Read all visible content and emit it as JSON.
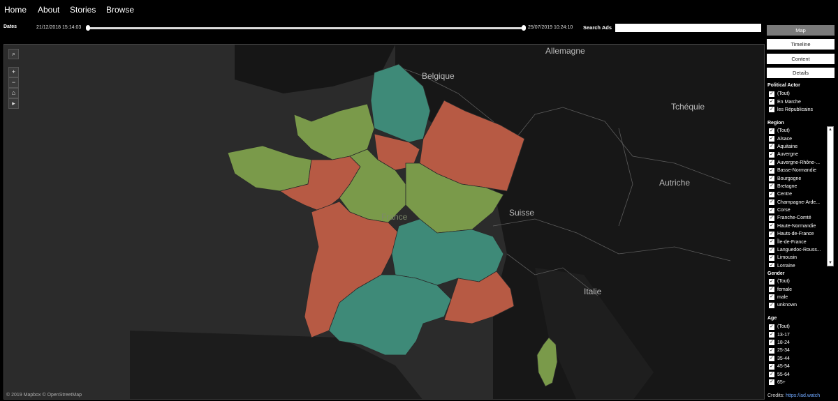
{
  "nav": {
    "home": "Home",
    "about": "About",
    "stories": "Stories",
    "browse": "Browse"
  },
  "dates": {
    "label": "Dates",
    "start": "21/12/2018 15:14:03",
    "end": "25/07/2019 10:24:10",
    "range_fraction": [
      0,
      1
    ]
  },
  "search": {
    "label": "Search Ads",
    "value": ""
  },
  "views": {
    "map": "Map",
    "timeline": "Timeline",
    "content": "Content",
    "details": "Details"
  },
  "map": {
    "attribution": "© 2019 Mapbox © OpenStreetMap",
    "country_labels": {
      "allemagne": "Allemagne",
      "belgique": "Belgique",
      "tcheque": "Tchéquie",
      "autriche": "Autriche",
      "suisse": "Suisse",
      "italie": "Italie",
      "france": "France"
    },
    "colors": {
      "background": "#2c2c2c",
      "green": "#7a9a4a",
      "teal": "#3e8a78",
      "red": "#b75a44"
    },
    "controls": {
      "search": "⌕",
      "zoom_in": "+",
      "zoom_out": "−",
      "home": "⌂",
      "expand": "▸"
    }
  },
  "filters": {
    "political_actor": {
      "title": "Political Actor",
      "items": [
        "(Tout)",
        "En Marche",
        "les Républicains"
      ]
    },
    "region": {
      "title": "Region",
      "items": [
        "(Tout)",
        "Alsace",
        "Aquitaine",
        "Auvergne",
        "Auvergne-Rhône-...",
        "Basse-Normandie",
        "Bourgogne",
        "Bretagne",
        "Centre",
        "Champagne-Arde...",
        "Corse",
        "Franche-Comté",
        "Haute-Normandie",
        "Hauts-de-France",
        "Île-de-France",
        "Languedoc-Rouss...",
        "Limousin",
        "Lorraine"
      ]
    },
    "gender": {
      "title": "Gender",
      "items": [
        "(Tout)",
        "female",
        "male",
        "unknown"
      ]
    },
    "age": {
      "title": "Age",
      "items": [
        "(Tout)",
        "13-17",
        "18-24",
        "25-34",
        "35-44",
        "45-54",
        "55-64",
        "65+"
      ]
    }
  },
  "credits": {
    "label": "Credits:",
    "link": "https://ad.watch"
  }
}
